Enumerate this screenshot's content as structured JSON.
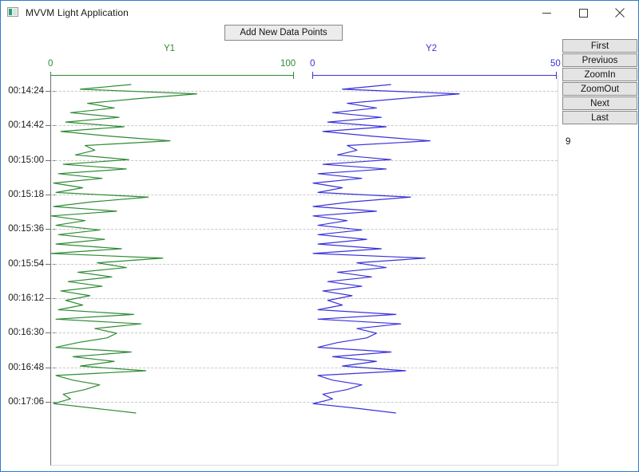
{
  "window": {
    "title": "MVVM Light Application",
    "icon": "app-chart-icon",
    "controls": [
      {
        "name": "minimize",
        "glyph": "minimize-icon"
      },
      {
        "name": "maximize",
        "glyph": "maximize-icon"
      },
      {
        "name": "close",
        "glyph": "close-icon"
      }
    ],
    "accent_border": "#2d7dd2"
  },
  "toolbar": {
    "add_points_label": "Add New Data Points"
  },
  "sidebar": {
    "buttons": [
      {
        "label": "First"
      },
      {
        "label": "Previuos"
      },
      {
        "label": "ZoomIn"
      },
      {
        "label": "ZoomOut"
      },
      {
        "label": "Next"
      },
      {
        "label": "Last"
      }
    ],
    "value": "9"
  },
  "chart_data": {
    "type": "line",
    "title": "",
    "orientation": "horizontal-value-vertical-time",
    "grid": true,
    "legend_position": "top",
    "xlabel": "",
    "ylabel": "",
    "y_axis": {
      "type": "time",
      "tick_labels": [
        "00:14:24",
        "00:14:42",
        "00:15:00",
        "00:15:18",
        "00:15:36",
        "00:15:54",
        "00:16:12",
        "00:16:30",
        "00:16:48",
        "00:17:06"
      ],
      "tick_interval_seconds": 18,
      "range": [
        "00:14:15",
        "00:17:20"
      ]
    },
    "series": [
      {
        "name": "Y1",
        "color": "#2e8b35",
        "axis": "top-1",
        "xlim": [
          0,
          100
        ],
        "tick_labels": [
          "0",
          "100"
        ],
        "values": [
          33,
          12,
          60,
          36,
          15,
          26,
          8,
          28,
          6,
          30,
          4,
          24,
          49,
          14,
          18,
          10,
          32,
          5,
          31,
          3,
          21,
          1,
          13,
          2,
          40,
          17,
          1,
          27,
          0,
          14,
          2,
          20,
          3,
          22,
          2,
          29,
          0,
          46,
          19,
          31,
          11,
          25,
          7,
          21,
          4,
          16,
          6,
          13,
          3,
          34,
          2,
          37,
          18,
          27,
          23,
          11,
          2,
          33,
          9,
          26,
          12,
          39,
          2,
          9,
          20,
          14,
          5,
          8,
          1,
          18,
          35
        ]
      },
      {
        "name": "Y2",
        "color": "#3a33d8",
        "axis": "top-2",
        "xlim": [
          0,
          50
        ],
        "tick_labels": [
          "0",
          "50"
        ],
        "values": [
          16,
          6,
          30,
          18,
          7,
          13,
          4,
          14,
          3,
          15,
          2,
          12,
          24,
          7,
          9,
          5,
          16,
          2,
          15,
          1,
          10,
          0,
          6,
          1,
          20,
          8,
          0,
          13,
          0,
          7,
          1,
          10,
          1,
          11,
          1,
          14,
          0,
          23,
          9,
          15,
          5,
          12,
          3,
          10,
          2,
          8,
          3,
          6,
          1,
          17,
          1,
          18,
          9,
          13,
          11,
          5,
          1,
          16,
          4,
          13,
          6,
          19,
          1,
          4,
          10,
          7,
          2,
          4,
          0,
          9,
          17
        ]
      }
    ]
  }
}
